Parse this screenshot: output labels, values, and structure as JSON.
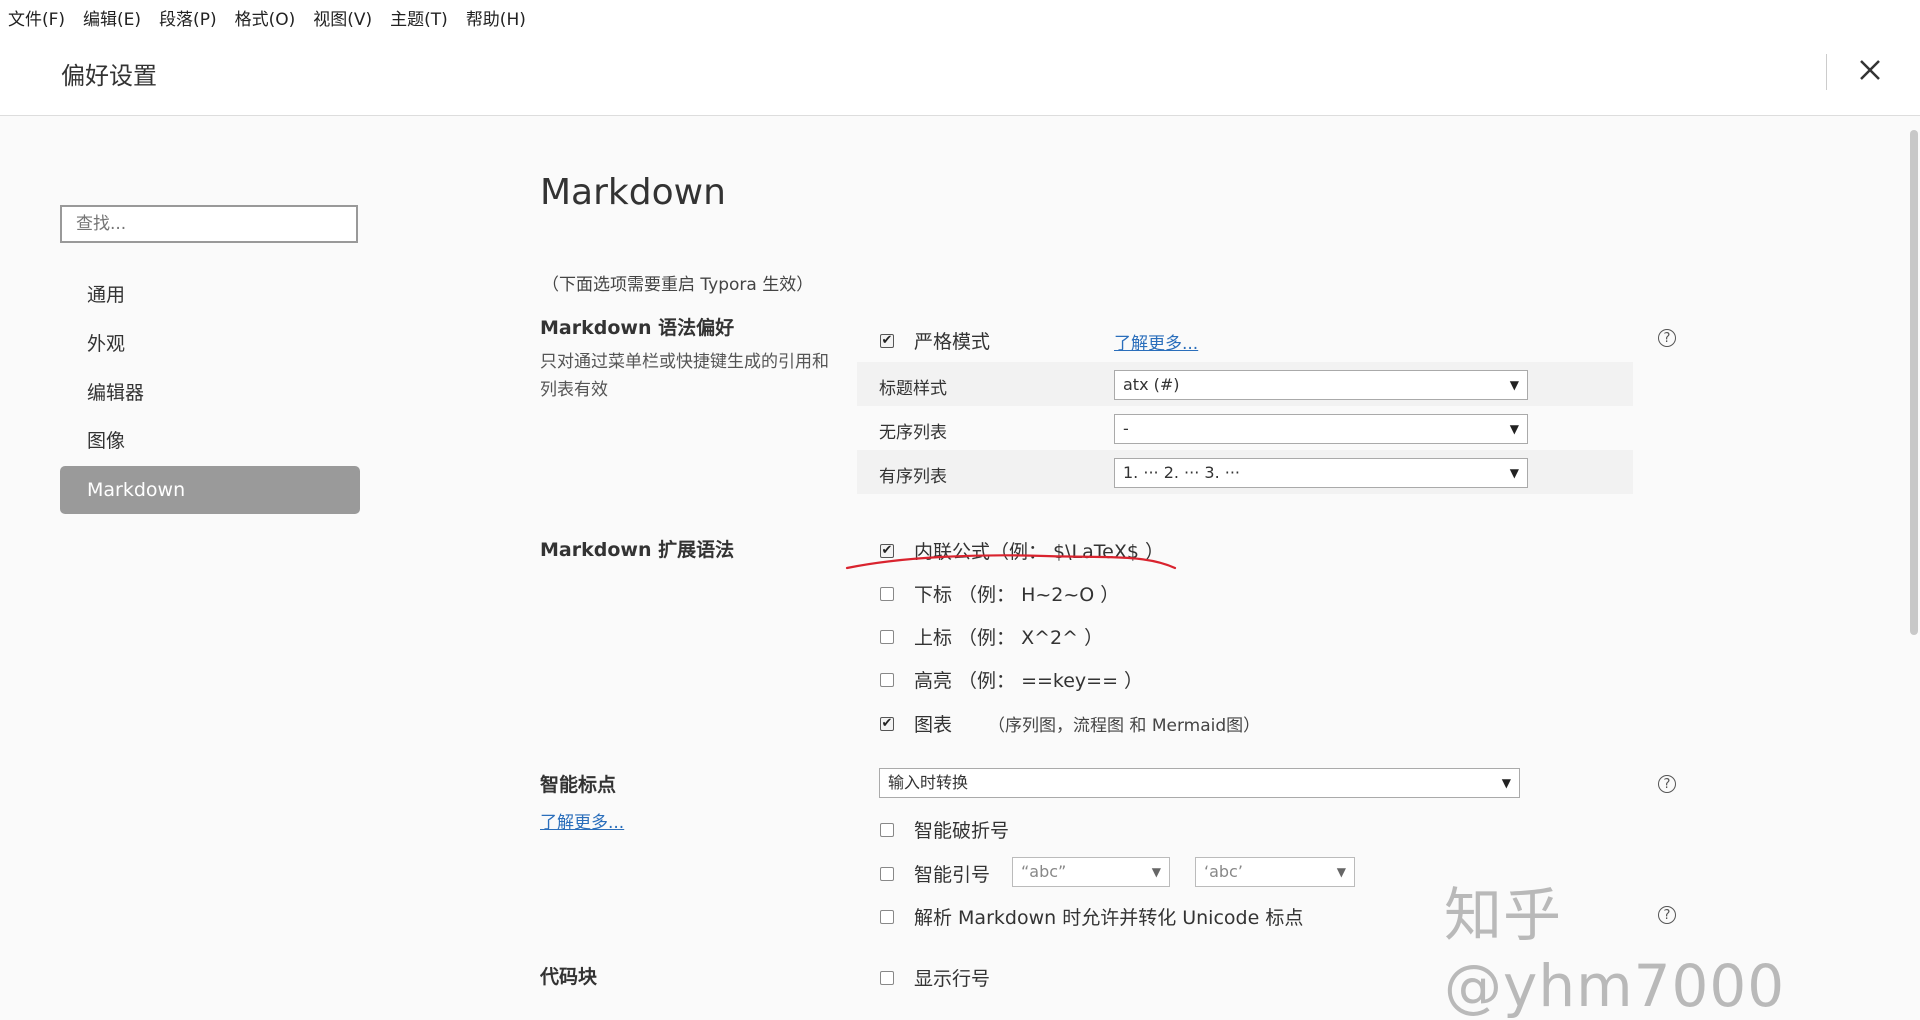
{
  "menu": [
    "文件(F)",
    "编辑(E)",
    "段落(P)",
    "格式(O)",
    "视图(V)",
    "主题(T)",
    "帮助(H)"
  ],
  "header": {
    "title": "偏好设置"
  },
  "sidebar": {
    "search_placeholder": "查找...",
    "items": [
      {
        "label": "通用"
      },
      {
        "label": "外观"
      },
      {
        "label": "编辑器"
      },
      {
        "label": "图像"
      },
      {
        "label": "Markdown",
        "active": true
      }
    ]
  },
  "main": {
    "title": "Markdown",
    "note": "（下面选项需要重启 Typora 生效）",
    "syntax_pref": {
      "title": "Markdown 语法偏好",
      "desc": "只对通过菜单栏或快捷键生成的引用和列表有效",
      "strict_label": "严格模式",
      "strict_checked": true,
      "learn_more": "了解更多...",
      "heading_label": "标题样式",
      "heading_value": "atx (#)",
      "ul_label": "无序列表",
      "ul_value": "-",
      "ol_label": "有序列表",
      "ol_value": "1. ··· 2. ··· 3. ···"
    },
    "ext_syntax": {
      "title": "Markdown 扩展语法",
      "items": [
        {
          "label": "内联公式（例： $\\LaTeX$ ）",
          "checked": true
        },
        {
          "label": "下标 （例： H~2~O ）",
          "checked": false
        },
        {
          "label": "上标 （例： X^2^ ）",
          "checked": false
        },
        {
          "label": "高亮 （例： ==key== ）",
          "checked": false
        },
        {
          "label": "图表",
          "checked": true
        }
      ],
      "diagram_note": "（序列图，流程图 和 Mermaid图）"
    },
    "smart_punct": {
      "title": "智能标点",
      "learn_more": "了解更多...",
      "select_value": "输入时转换",
      "dash_label": "智能破折号",
      "quote_label": "智能引号",
      "quote_double": "“abc”",
      "quote_single": "‘abc’",
      "unicode_label": "解析 Markdown 时允许并转化 Unicode 标点"
    },
    "code_block": {
      "title": "代码块",
      "line_numbers_label": "显示行号"
    }
  },
  "watermark": "知乎 @yhm7000",
  "accent_color": "#d9232e"
}
